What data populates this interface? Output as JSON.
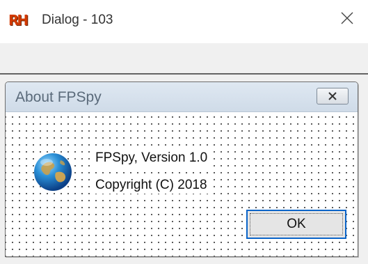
{
  "window": {
    "icon_text": "RH",
    "title": "Dialog - 103"
  },
  "dialog": {
    "title": "About FPSpy",
    "line1": "FPSpy, Version 1.0",
    "line2": "Copyright (C) 2018",
    "ok_label": "OK"
  },
  "icons": {
    "app": "resource-hacker-logo",
    "window_close": "close-icon",
    "dialog_close": "close-icon",
    "dialog_app": "globe-icon"
  },
  "colors": {
    "ok_focus_border": "#0a64c8",
    "dialog_titlebar": "#d6e1ed",
    "grid_dots": "#404040"
  }
}
